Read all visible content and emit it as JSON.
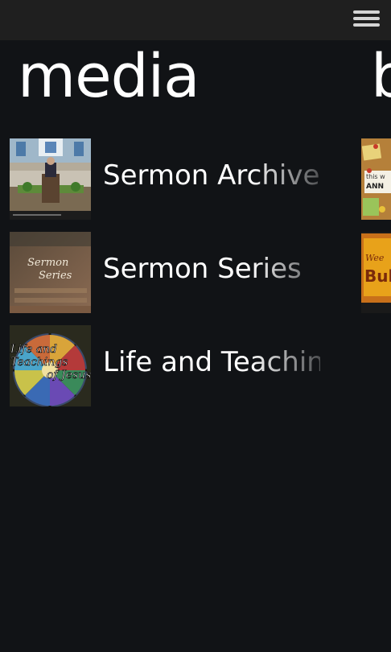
{
  "app_bar": {
    "menu_icon": "hamburger-menu-icon"
  },
  "panorama": {
    "current_section_title": "media",
    "next_section_title": "b"
  },
  "media_items": [
    {
      "label": "Sermon Archives",
      "thumbnail": "pastor-at-pulpit"
    },
    {
      "label": "Sermon Series",
      "thumbnail_text": "Sermon\nSeries"
    },
    {
      "label": "Life and Teachings",
      "thumbnail_text_1": "Life and",
      "thumbnail_text_2": "Teachings",
      "thumbnail_text_3": "of Jesus"
    }
  ],
  "peek_items": [
    {
      "text_1": "this w",
      "text_2": "ANN"
    },
    {
      "text_1": "Wee",
      "text_2": "Bul"
    }
  ],
  "colors": {
    "background": "#111316",
    "app_bar": "#1f1f1f",
    "text": "#ffffff",
    "menu_icon": "#d4d4d4"
  }
}
